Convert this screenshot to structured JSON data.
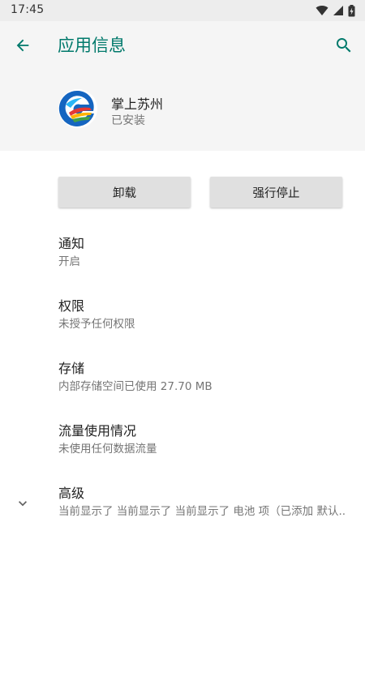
{
  "status_bar": {
    "time": "17:45",
    "icons": [
      "wifi-icon",
      "signal-icon",
      "battery-icon"
    ]
  },
  "header": {
    "title": "应用信息",
    "back_icon": "back-arrow-icon",
    "search_icon": "search-icon",
    "accent_color": "#00796b"
  },
  "app": {
    "name": "掌上苏州",
    "status": "已安装",
    "icon": "app-logo-icon"
  },
  "actions": {
    "uninstall_label": "卸载",
    "force_stop_label": "强行停止"
  },
  "prefs": {
    "notifications": {
      "title": "通知",
      "summary": "开启"
    },
    "permissions": {
      "title": "权限",
      "summary": "未授予任何权限"
    },
    "storage": {
      "title": "存储",
      "summary": "内部存储空间已使用 27.70 MB"
    },
    "data_usage": {
      "title": "流量使用情况",
      "summary": "未使用任何数据流量"
    },
    "advanced": {
      "title": "高级",
      "summary": "当前显示了 当前显示了 当前显示了 电池 项（已添加 默认..",
      "icon": "chevron-down-icon"
    }
  }
}
